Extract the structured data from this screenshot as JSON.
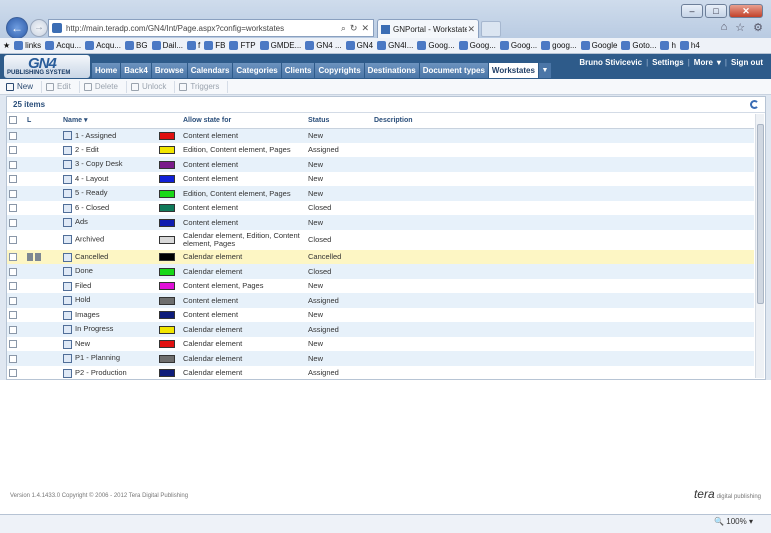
{
  "browser": {
    "url": "http://main.teradp.com/GN4/Int/Page.aspx?config=workstates",
    "tab_title": "GNPortal - Workstates (Ad...",
    "favorites": [
      "links",
      "Acqu...",
      "Acqu...",
      "BG",
      "Dail...",
      "f",
      "FB",
      "FTP",
      "GMDE...",
      "GN4 ...",
      "GN4",
      "GN4I...",
      "Goog...",
      "Goog...",
      "Goog...",
      "goog...",
      "Google",
      "Goto...",
      "h",
      "h4"
    ]
  },
  "app": {
    "logo": "GN4",
    "logo_sub": "PUBLISHING SYSTEM",
    "nav": [
      "Home",
      "Back4",
      "Browse",
      "Calendars",
      "Categories",
      "Clients",
      "Copyrights",
      "Destinations",
      "Document types",
      "Workstates"
    ],
    "active_nav": "Workstates",
    "user": "Bruno Stivicevic",
    "settings": "Settings",
    "more": "More",
    "signout": "Sign out"
  },
  "toolbar": {
    "new": "New",
    "edit": "Edit",
    "delete": "Delete",
    "unlock": "Unlock",
    "triggers": "Triggers"
  },
  "grid": {
    "count": "25 items",
    "headers": {
      "l": "L",
      "name": "Name",
      "allow": "Allow state for",
      "status": "Status",
      "description": "Description"
    },
    "rows": [
      {
        "name": "1 - Assigned",
        "color": "#e01010",
        "allow": "Content element",
        "status": "New"
      },
      {
        "name": "2 - Edit",
        "color": "#f2e600",
        "allow": "Edition, Content element, Pages",
        "status": "Assigned"
      },
      {
        "name": "3 - Copy Desk",
        "color": "#7a1a8a",
        "allow": "Content element",
        "status": "New"
      },
      {
        "name": "4 - Layout",
        "color": "#1020d8",
        "allow": "Content element",
        "status": "New"
      },
      {
        "name": "5 - Ready",
        "color": "#18d818",
        "allow": "Edition, Content element, Pages",
        "status": "New"
      },
      {
        "name": "6 - Closed",
        "color": "#0f7a5a",
        "allow": "Content element",
        "status": "Closed"
      },
      {
        "name": "Ads",
        "color": "#0d1bb0",
        "allow": "Content element",
        "status": "New"
      },
      {
        "name": "Archived",
        "color": "#d9d9d9",
        "allow": "Calendar element, Edition, Content element, Pages",
        "status": "Closed"
      },
      {
        "name": "Cancelled",
        "color": "#000000",
        "allow": "Calendar element",
        "status": "Cancelled"
      },
      {
        "name": "Done",
        "color": "#18d818",
        "allow": "Calendar element",
        "status": "Closed"
      },
      {
        "name": "Filed",
        "color": "#e010d8",
        "allow": "Content element, Pages",
        "status": "New"
      },
      {
        "name": "Hold",
        "color": "#6e6e6e",
        "allow": "Content element",
        "status": "Assigned"
      },
      {
        "name": "Images",
        "color": "#0d1b7a",
        "allow": "Content element",
        "status": "New"
      },
      {
        "name": "In Progress",
        "color": "#f2e600",
        "allow": "Calendar element",
        "status": "Assigned"
      },
      {
        "name": "New",
        "color": "#e01010",
        "allow": "Calendar element",
        "status": "New"
      },
      {
        "name": "P1 - Planning",
        "color": "#6e6e6e",
        "allow": "Calendar element",
        "status": "New"
      },
      {
        "name": "P2 - Production",
        "color": "#0d1b7a",
        "allow": "Calendar element",
        "status": "Assigned"
      }
    ]
  },
  "footer": {
    "version": "Version 1.4.1433.0 Copyright © 2006 - 2012 Tera Digital Publishing",
    "brand": "tera",
    "brand_sub": "digital publishing",
    "zoom": "100%"
  }
}
